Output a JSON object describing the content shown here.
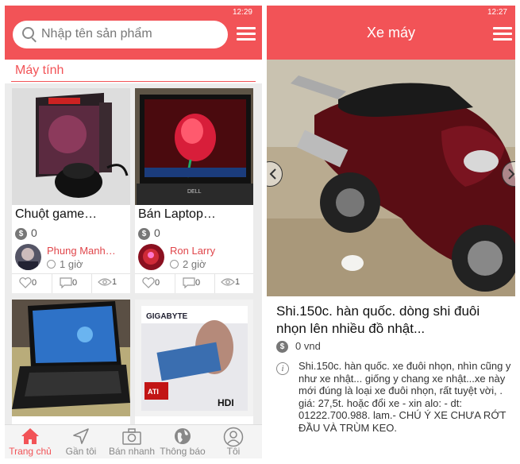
{
  "left": {
    "status_time": "12:29",
    "search_placeholder": "Nhập tên sản phẩm",
    "category": "Máy tính",
    "cards": [
      {
        "title": "Chuột game…",
        "price": "0",
        "user": "Phung Manh…",
        "time": "1 giờ",
        "likes": "0",
        "comments": "0",
        "views": "1"
      },
      {
        "title": "Bán Laptop…",
        "price": "0",
        "user": "Ron Larry",
        "time": "2 giờ",
        "likes": "0",
        "comments": "0",
        "views": "1"
      }
    ],
    "nav": [
      {
        "label": "Trang chủ",
        "icon": "home-icon"
      },
      {
        "label": "Gần tôi",
        "icon": "location-arrow-icon"
      },
      {
        "label": "Bán nhanh",
        "icon": "camera-icon"
      },
      {
        "label": "Thông báo",
        "icon": "globe-icon"
      },
      {
        "label": "Tôi",
        "icon": "user-icon"
      }
    ]
  },
  "right": {
    "status_time": "12:27",
    "title": "Xe máy",
    "item_name": "Shi.150c. hàn quốc. dòng shi đuôi nhọn lên nhiều đồ nhật...",
    "price": "0 vnd",
    "description": "Shi.150c. hàn quốc. xe đuôi nhọn, nhìn cũng y như xe nhật... giống y chang xe nhật...xe này mới đúng là loại xe đuôi nhọn, rất tuyệt vời, . giá: 27,5t. hoặc đổi xe - xin alo: - dt: 01222.700.988. lam.- CHÚ Ý XE CHƯA RỚT ĐẦU VÀ TRÙM KEO."
  },
  "colors": {
    "accent": "#f25357",
    "user_name": "#e0464b"
  }
}
